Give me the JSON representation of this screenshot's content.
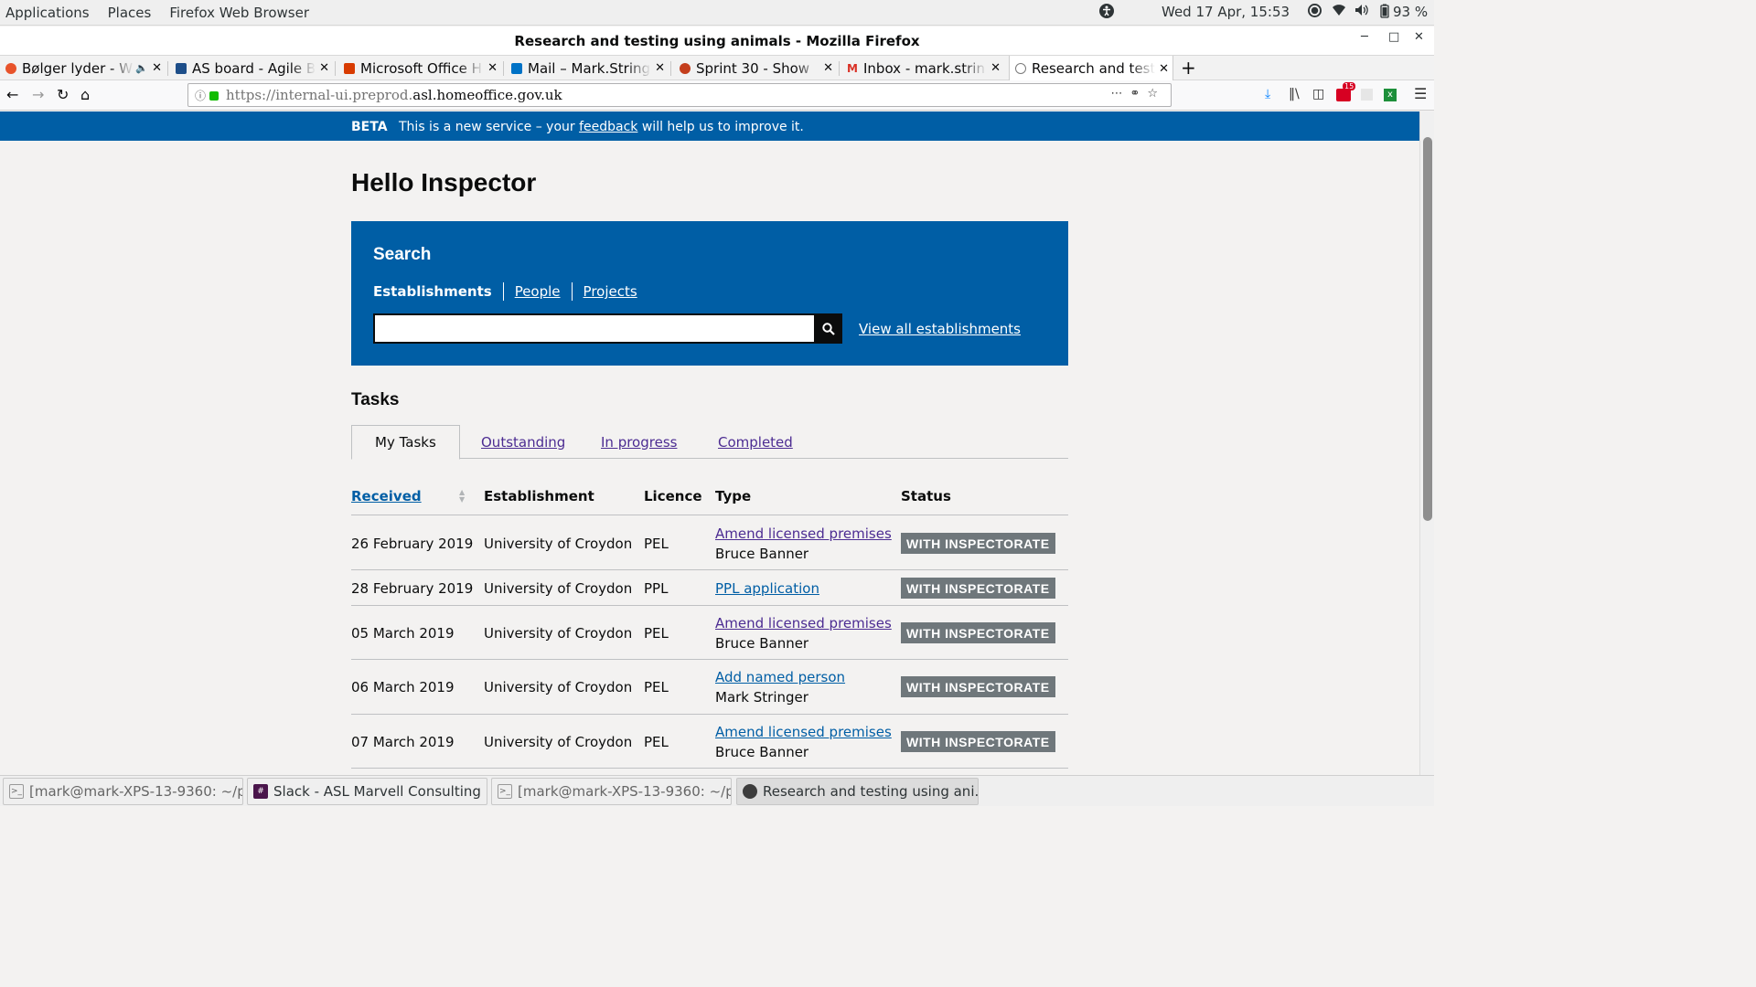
{
  "system_bar": {
    "menus": [
      "Applications",
      "Places",
      "Firefox Web Browser"
    ],
    "datetime": "Wed 17 Apr, 15:53",
    "battery": "93 %"
  },
  "window": {
    "title": "Research and testing using animals - Mozilla Firefox"
  },
  "tabs": [
    {
      "label": "Bølger lyder - W",
      "favicon_color": "#e8532a"
    },
    {
      "label": "AS board - Agile B",
      "favicon_color": "#1d4e89"
    },
    {
      "label": "Microsoft Office H",
      "favicon_color": "#d83b01"
    },
    {
      "label": "Mail – Mark.String",
      "favicon_color": "#0072c6"
    },
    {
      "label": "Sprint 30 - Show",
      "favicon_color": "#c43e1c"
    },
    {
      "label": "Inbox - mark.strin",
      "favicon_color": "#d93025"
    },
    {
      "label": "Research and testi",
      "favicon_color": "#7a7a7a"
    }
  ],
  "url": {
    "prefix": "https://internal-ui.preprod.",
    "domain": "asl.homeoffice.gov.uk"
  },
  "toolbar": {
    "notification_count": "15"
  },
  "banner": {
    "tag": "BETA",
    "text_before": "This is a new service – your ",
    "link": "feedback",
    "text_after": " will help us to improve it."
  },
  "page": {
    "greeting": "Hello Inspector"
  },
  "search": {
    "title": "Search",
    "tabs": [
      "Establishments",
      "People",
      "Projects"
    ],
    "input_value": "",
    "view_all": "View all establishments"
  },
  "tasks": {
    "title": "Tasks",
    "tabs": [
      "My Tasks",
      "Outstanding",
      "In progress",
      "Completed"
    ],
    "columns": [
      "Received",
      "Establishment",
      "Licence",
      "Type",
      "Status"
    ],
    "rows": [
      {
        "received": "26 February 2019",
        "establishment": "University of Croydon",
        "licence": "PEL",
        "type": "Amend licensed premises",
        "person": "Bruce Banner",
        "status": "WITH INSPECTORATE"
      },
      {
        "received": "28 February 2019",
        "establishment": "University of Croydon",
        "licence": "PPL",
        "type": "PPL application",
        "person": "",
        "status": "WITH INSPECTORATE"
      },
      {
        "received": "05 March 2019",
        "establishment": "University of Croydon",
        "licence": "PEL",
        "type": "Amend licensed premises",
        "person": "Bruce Banner",
        "status": "WITH INSPECTORATE"
      },
      {
        "received": "06 March 2019",
        "establishment": "University of Croydon",
        "licence": "PEL",
        "type": "Add named person",
        "person": "Mark Stringer",
        "status": "WITH INSPECTORATE"
      },
      {
        "received": "07 March 2019",
        "establishment": "University of Croydon",
        "licence": "PEL",
        "type": "Amend licensed premises",
        "person": "Bruce Banner",
        "status": "WITH INSPECTORATE"
      }
    ]
  },
  "taskbar": [
    {
      "label": "[mark@mark-XPS-13-9360: ~/p...",
      "icon": "terminal-icon"
    },
    {
      "label": "Slack - ASL Marvell Consulting",
      "icon": "slack-icon"
    },
    {
      "label": "[mark@mark-XPS-13-9360: ~/p...",
      "icon": "terminal-icon"
    },
    {
      "label": "Research and testing using ani...",
      "icon": "firefox-icon"
    }
  ]
}
